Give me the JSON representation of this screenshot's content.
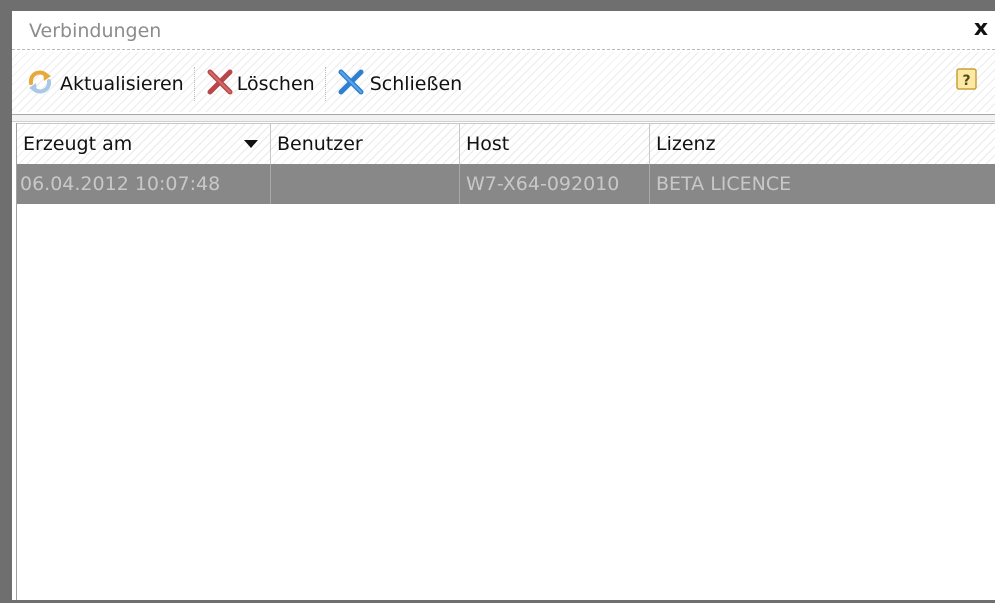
{
  "window": {
    "title": "Verbindungen",
    "close_symbol": "x"
  },
  "toolbar": {
    "buttons": [
      {
        "label": "Aktualisieren",
        "icon": "refresh-icon"
      },
      {
        "label": "Löschen",
        "icon": "delete-icon"
      },
      {
        "label": "Schließen",
        "icon": "close-connection-icon"
      }
    ],
    "help_icon": "help-icon",
    "help_symbol": "?"
  },
  "table": {
    "columns": [
      {
        "label": "Erzeugt am",
        "sorted": "descending"
      },
      {
        "label": "Benutzer"
      },
      {
        "label": "Host"
      },
      {
        "label": "Lizenz"
      }
    ],
    "rows": [
      {
        "created": "06.04.2012 10:07:48",
        "user": "",
        "host": "W7-X64-092010",
        "license": "BETA LICENCE",
        "selected": true
      }
    ]
  },
  "colors": {
    "selected_row": "#888888",
    "selected_text": "#c8c8c8",
    "frame": "#6f6f6f"
  }
}
